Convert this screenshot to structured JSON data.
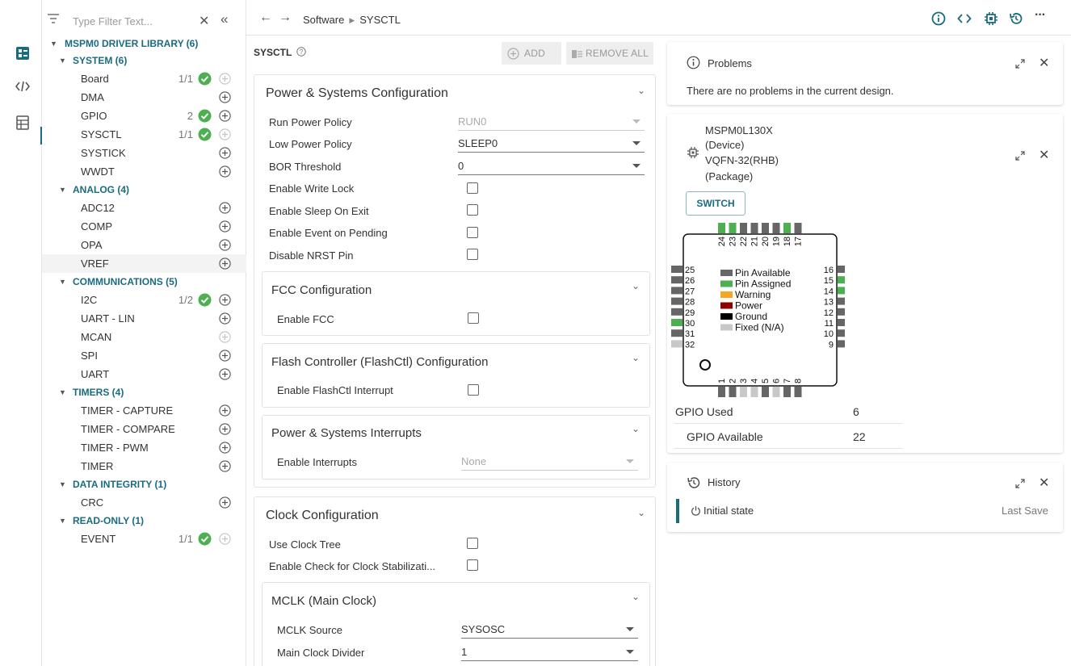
{
  "sidebar": {
    "filter_placeholder": "Type Filter Text...",
    "tree": [
      {
        "kind": "root",
        "label": "MSPM0 DRIVER LIBRARY (6)"
      },
      {
        "kind": "cat",
        "label": "SYSTEM (6)"
      },
      {
        "kind": "item",
        "label": "Board",
        "count": "1/1",
        "ok": true,
        "add_enabled": false
      },
      {
        "kind": "item",
        "label": "DMA",
        "count": "",
        "ok": false,
        "add_enabled": true
      },
      {
        "kind": "item",
        "label": "GPIO",
        "count": "2",
        "ok": true,
        "add_enabled": true
      },
      {
        "kind": "item",
        "label": "SYSCTL",
        "count": "1/1",
        "ok": true,
        "add_enabled": false
      },
      {
        "kind": "item",
        "label": "SYSTICK",
        "count": "",
        "ok": false,
        "add_enabled": true
      },
      {
        "kind": "item",
        "label": "WWDT",
        "count": "",
        "ok": false,
        "add_enabled": true
      },
      {
        "kind": "cat",
        "label": "ANALOG (4)"
      },
      {
        "kind": "item",
        "label": "ADC12",
        "count": "",
        "ok": false,
        "add_enabled": true
      },
      {
        "kind": "item",
        "label": "COMP",
        "count": "",
        "ok": false,
        "add_enabled": true
      },
      {
        "kind": "item",
        "label": "OPA",
        "count": "",
        "ok": false,
        "add_enabled": true
      },
      {
        "kind": "item",
        "label": "VREF",
        "count": "",
        "ok": false,
        "add_enabled": true,
        "highlight": true
      },
      {
        "kind": "cat",
        "label": "COMMUNICATIONS (5)"
      },
      {
        "kind": "item",
        "label": "I2C",
        "count": "1/2",
        "ok": true,
        "add_enabled": true
      },
      {
        "kind": "item",
        "label": "UART - LIN",
        "count": "",
        "ok": false,
        "add_enabled": true
      },
      {
        "kind": "item",
        "label": "MCAN",
        "count": "",
        "ok": false,
        "add_enabled": false
      },
      {
        "kind": "item",
        "label": "SPI",
        "count": "",
        "ok": false,
        "add_enabled": true
      },
      {
        "kind": "item",
        "label": "UART",
        "count": "",
        "ok": false,
        "add_enabled": true
      },
      {
        "kind": "cat",
        "label": "TIMERS (4)"
      },
      {
        "kind": "item",
        "label": "TIMER - CAPTURE",
        "count": "",
        "ok": false,
        "add_enabled": true
      },
      {
        "kind": "item",
        "label": "TIMER - COMPARE",
        "count": "",
        "ok": false,
        "add_enabled": true
      },
      {
        "kind": "item",
        "label": "TIMER - PWM",
        "count": "",
        "ok": false,
        "add_enabled": true
      },
      {
        "kind": "item",
        "label": "TIMER",
        "count": "",
        "ok": false,
        "add_enabled": true
      },
      {
        "kind": "cat",
        "label": "DATA INTEGRITY (1)"
      },
      {
        "kind": "item",
        "label": "CRC",
        "count": "",
        "ok": false,
        "add_enabled": true
      },
      {
        "kind": "cat",
        "label": "READ-ONLY (1)"
      },
      {
        "kind": "item",
        "label": "EVENT",
        "count": "1/1",
        "ok": true,
        "add_enabled": false
      }
    ]
  },
  "topbar": {
    "crumb_1": "Software",
    "crumb_2": "SYSCTL",
    "icons": [
      "info-icon",
      "code-icon",
      "chip-icon",
      "history-icon",
      "more-icon"
    ]
  },
  "center": {
    "title": "SYSCTL",
    "add_label": "ADD",
    "remove_all_label": "REMOVE ALL",
    "power_card": {
      "title": "Power & Systems Configuration",
      "run_power_policy": {
        "label": "Run Power Policy",
        "value": "RUN0"
      },
      "low_power_policy": {
        "label": "Low Power Policy",
        "value": "SLEEP0"
      },
      "bor_threshold": {
        "label": "BOR Threshold",
        "value": "0"
      },
      "write_lock": "Enable Write Lock",
      "sleep_on_exit": "Enable Sleep On Exit",
      "event_on_pending": "Enable Event on Pending",
      "disable_nrst": "Disable NRST Pin",
      "fcc": {
        "title": "FCC Configuration",
        "enable": "Enable FCC"
      },
      "flashctl": {
        "title": "Flash Controller (FlashCtl) Configuration",
        "enable": "Enable FlashCtl Interrupt"
      },
      "interrupts": {
        "title": "Power & Systems Interrupts",
        "enable": "Enable Interrupts",
        "value": "None"
      }
    },
    "clock_card": {
      "title": "Clock Configuration",
      "use_clock_tree": "Use Clock Tree",
      "clock_stab": "Enable Check for Clock Stabilizati...",
      "mclk": {
        "title": "MCLK (Main Clock)",
        "source": {
          "label": "MCLK Source",
          "value": "SYSOSC"
        },
        "divider": {
          "label": "Main Clock Divider",
          "value": "1"
        }
      }
    }
  },
  "problems": {
    "title": "Problems",
    "message": "There are no problems in the current design."
  },
  "device": {
    "device_name": "MSPM0L130X",
    "device_tag": "(Device)",
    "package_name": "VQFN-32(RHB)",
    "package_tag": "(Package)",
    "switch_label": "SWITCH",
    "legend": [
      {
        "label": "Pin Available",
        "color": "#666666"
      },
      {
        "label": "Pin Assigned",
        "color": "#4caf50"
      },
      {
        "label": "Warning",
        "color": "#f5a623"
      },
      {
        "label": "Power",
        "color": "#8b0000"
      },
      {
        "label": "Ground",
        "color": "#000000"
      },
      {
        "label": "Fixed (N/A)",
        "color": "#c8c8c8"
      }
    ],
    "pins_top": [
      "24",
      "23",
      "22",
      "21",
      "20",
      "19",
      "18",
      "17"
    ],
    "pins_left": [
      "25",
      "26",
      "27",
      "28",
      "29",
      "30",
      "31",
      "32"
    ],
    "pins_right": [
      "16",
      "15",
      "14",
      "13",
      "12",
      "11",
      "10",
      "9"
    ],
    "pins_bottom": [
      "1",
      "2",
      "3",
      "4",
      "5",
      "6",
      "7",
      "8"
    ],
    "gpio_used_label": "GPIO Used",
    "gpio_used_value": "6",
    "gpio_available_label": "GPIO Available",
    "gpio_available_value": "22"
  },
  "history": {
    "title": "History",
    "entry": "Initial state",
    "status": "Last Save"
  },
  "colors": {
    "accent": "#1b6b80",
    "ok_green": "#4caf50",
    "pin_gray": "#666666",
    "pin_green": "#4caf50",
    "pin_fixed": "#c8c8c8"
  }
}
